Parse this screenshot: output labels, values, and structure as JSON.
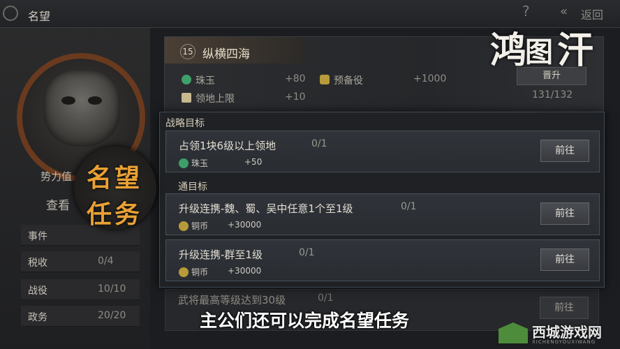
{
  "header": {
    "title": "名望",
    "help": "?",
    "back_label": "返回",
    "back_icon": "«"
  },
  "left": {
    "faction_label": "势力值",
    "faction_link": "查看",
    "stats": [
      {
        "label": "事件",
        "value": ""
      },
      {
        "label": "税收",
        "value": "0/4"
      },
      {
        "label": "战役",
        "value": "10/10"
      },
      {
        "label": "政务",
        "value": "20/20"
      }
    ]
  },
  "rank": {
    "number": "15",
    "name": "纵横四海",
    "rewards": [
      {
        "name": "珠玉",
        "value": "+80"
      },
      {
        "name": "预备役",
        "value": "+1000"
      },
      {
        "name": "领地上限",
        "value": "+10"
      }
    ],
    "promote_label": "晋升",
    "progress": "131/132"
  },
  "logo": {
    "chars": [
      "鸿",
      "图",
      "汗"
    ]
  },
  "modal": {
    "section1": "战略目标",
    "section2": "通目标",
    "tasks": [
      {
        "title": "占领1块6级以上领地",
        "progress": "0/1",
        "reward_name": "珠玉",
        "reward_value": "+50",
        "button": "前往"
      },
      {
        "title": "升级连携-魏、蜀、吴中任意1个至1级",
        "progress": "0/1",
        "reward_name": "铜币",
        "reward_value": "+30000",
        "button": "前往"
      },
      {
        "title": "升级连携-群至1级",
        "progress": "0/1",
        "reward_name": "铜币",
        "reward_value": "+30000",
        "button": "前往"
      }
    ]
  },
  "dim_task": {
    "title": "武将最高等级达到30级",
    "progress": "0/1",
    "button": "前往"
  },
  "overlay": {
    "line1": "名望",
    "line2": "任务"
  },
  "subtitle": "主公们还可以完成名望任务",
  "site": {
    "name": "西城游戏网",
    "sub": "XICHENGYOUXIWANG"
  },
  "colors": {
    "accent": "#e9a035",
    "gem": "#3f9f6a",
    "coin": "#b79a3a"
  }
}
